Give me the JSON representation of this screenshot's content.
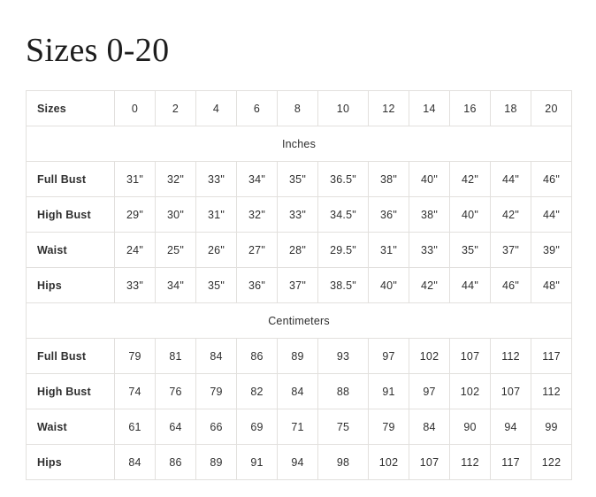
{
  "page": {
    "title": "Sizes 0-20",
    "background_color": "#ffffff"
  },
  "table": {
    "border_color": "#e2e0dd",
    "section_band_color": "#f7f4f0",
    "header": {
      "label": "Sizes",
      "sizes": [
        "0",
        "2",
        "4",
        "6",
        "8",
        "10",
        "12",
        "14",
        "16",
        "18",
        "20"
      ]
    },
    "sections": [
      {
        "name": "Inches",
        "rows": [
          {
            "label": "Full Bust",
            "values": [
              "31\"",
              "32\"",
              "33\"",
              "34\"",
              "35\"",
              "36.5\"",
              "38\"",
              "40\"",
              "42\"",
              "44\"",
              "46\""
            ]
          },
          {
            "label": "High Bust",
            "values": [
              "29\"",
              "30\"",
              "31\"",
              "32\"",
              "33\"",
              "34.5\"",
              "36\"",
              "38\"",
              "40\"",
              "42\"",
              "44\""
            ]
          },
          {
            "label": "Waist",
            "values": [
              "24\"",
              "25\"",
              "26\"",
              "27\"",
              "28\"",
              "29.5\"",
              "31\"",
              "33\"",
              "35\"",
              "37\"",
              "39\""
            ]
          },
          {
            "label": "Hips",
            "values": [
              "33\"",
              "34\"",
              "35\"",
              "36\"",
              "37\"",
              "38.5\"",
              "40\"",
              "42\"",
              "44\"",
              "46\"",
              "48\""
            ]
          }
        ]
      },
      {
        "name": "Centimeters",
        "rows": [
          {
            "label": "Full Bust",
            "values": [
              "79",
              "81",
              "84",
              "86",
              "89",
              "93",
              "97",
              "102",
              "107",
              "112",
              "117"
            ]
          },
          {
            "label": "High Bust",
            "values": [
              "74",
              "76",
              "79",
              "82",
              "84",
              "88",
              "91",
              "97",
              "102",
              "107",
              "112"
            ]
          },
          {
            "label": "Waist",
            "values": [
              "61",
              "64",
              "66",
              "69",
              "71",
              "75",
              "79",
              "84",
              "90",
              "94",
              "99"
            ]
          },
          {
            "label": "Hips",
            "values": [
              "84",
              "86",
              "89",
              "91",
              "94",
              "98",
              "102",
              "107",
              "112",
              "117",
              "122"
            ]
          }
        ]
      }
    ]
  }
}
